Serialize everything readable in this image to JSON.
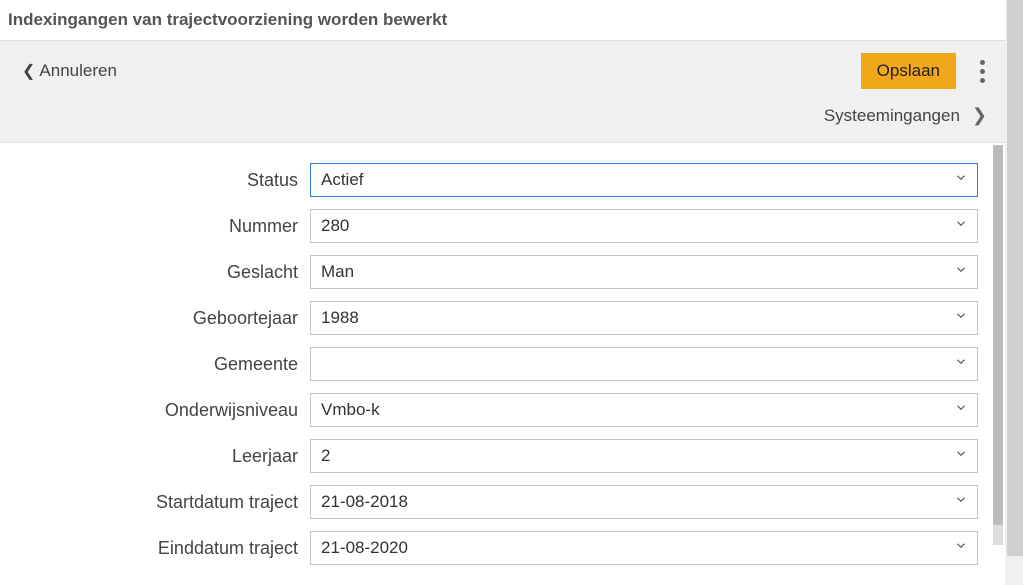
{
  "header": {
    "title": "Indexingangen van trajectvoorziening worden bewerkt"
  },
  "toolbar": {
    "cancel_label": "Annuleren",
    "save_label": "Opslaan"
  },
  "subnav": {
    "label": "Systeemingangen"
  },
  "form": {
    "fields": [
      {
        "label": "Status",
        "value": "Actief",
        "focused": true
      },
      {
        "label": "Nummer",
        "value": "280",
        "focused": false
      },
      {
        "label": "Geslacht",
        "value": "Man",
        "focused": false
      },
      {
        "label": "Geboortejaar",
        "value": "1988",
        "focused": false
      },
      {
        "label": "Gemeente",
        "value": "",
        "focused": false
      },
      {
        "label": "Onderwijsniveau",
        "value": "Vmbo-k",
        "focused": false
      },
      {
        "label": "Leerjaar",
        "value": "2",
        "focused": false
      },
      {
        "label": "Startdatum traject",
        "value": "21-08-2018",
        "focused": false
      },
      {
        "label": "Einddatum traject",
        "value": "21-08-2020",
        "focused": false
      }
    ]
  }
}
